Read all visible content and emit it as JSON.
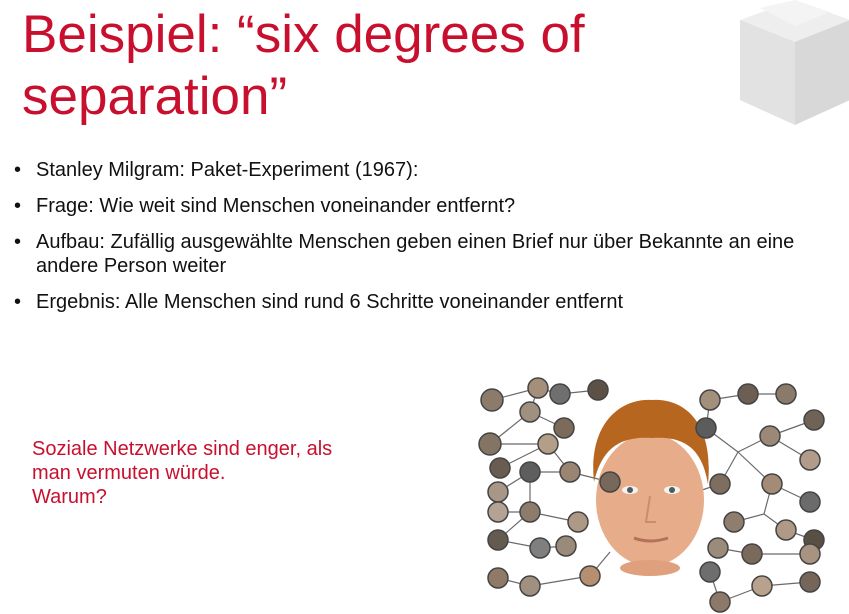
{
  "slide": {
    "title_line1": "Beispiel: “six degrees of",
    "title_line2": "separation”",
    "bullets": [
      "Stanley Milgram: Paket-Experiment (1967):",
      "Frage: Wie weit sind Menschen voneinander entfernt?",
      "Aufbau: Zufällig ausgewählte Menschen geben einen Brief nur über Bekannte an eine andere Person weiter",
      "Ergebnis: Alle Menschen sind rund 6 Schritte voneinander entfernt"
    ],
    "callout_lines": [
      "Soziale Netzwerke sind enger, als",
      "man vermuten würde.",
      "Warum?"
    ]
  },
  "colors": {
    "accent": "#c8102e",
    "text": "#111111",
    "logo": "#e6e6e6"
  },
  "icons": {
    "logo": "cube-logo-icon",
    "bullet": "bullet-dot-icon"
  }
}
